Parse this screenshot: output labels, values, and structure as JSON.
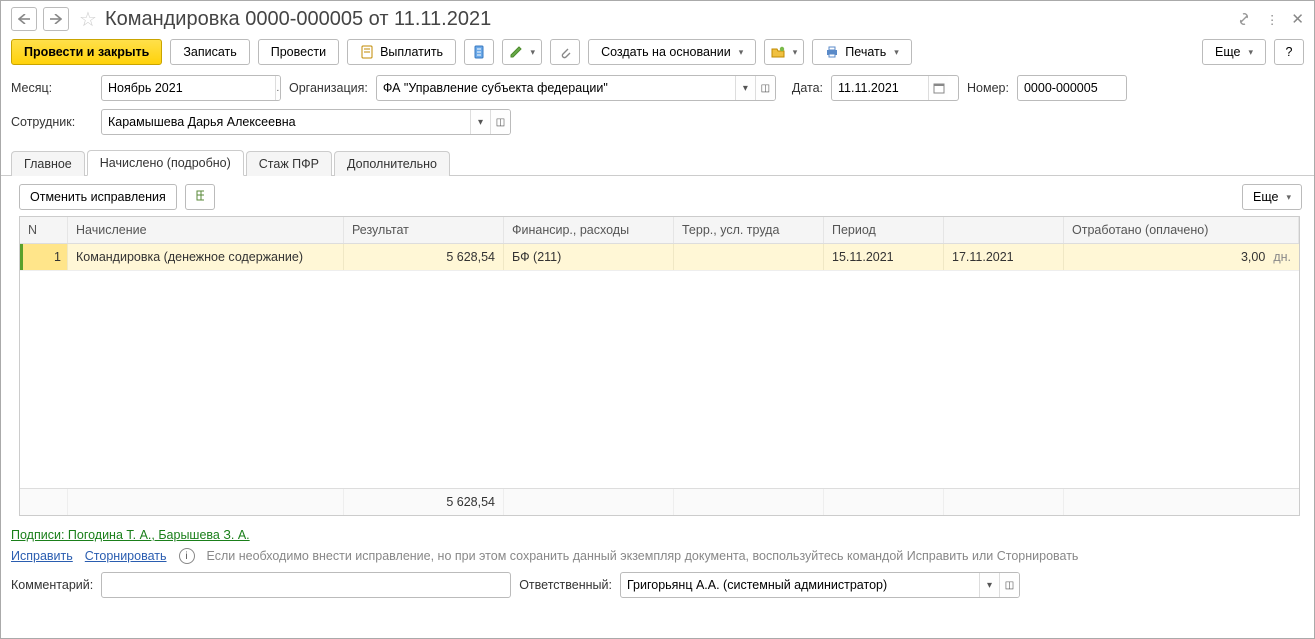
{
  "title": "Командировка 0000-000005 от 11.11.2021",
  "toolbar": {
    "post_close": "Провести и закрыть",
    "save": "Записать",
    "post": "Провести",
    "pay": "Выплатить",
    "create_based": "Создать на основании",
    "print": "Печать",
    "more": "Еще",
    "help": "?"
  },
  "labels": {
    "month": "Месяц:",
    "org": "Организация:",
    "date": "Дата:",
    "number": "Номер:",
    "employee": "Сотрудник:",
    "comment": "Комментарий:",
    "responsible": "Ответственный:"
  },
  "fields": {
    "month": "Ноябрь 2021",
    "org": "ФА \"Управление субъекта федерации\"",
    "date": "11.11.2021",
    "number": "0000-000005",
    "employee": "Карамышева Дарья Алексеевна",
    "comment": "",
    "responsible": "Григорьянц А.А. (системный администратор)"
  },
  "tabs": {
    "main": "Главное",
    "accruals": "Начислено (подробно)",
    "pfr": "Стаж ПФР",
    "extra": "Дополнительно"
  },
  "tab_toolbar": {
    "cancel_fix": "Отменить исправления",
    "more": "Еще"
  },
  "table": {
    "headers": {
      "n": "N",
      "accrual": "Начисление",
      "result": "Результат",
      "finance": "Финансир., расходы",
      "terr": "Терр., усл. труда",
      "period": "Период",
      "period2": "",
      "worked": "Отработано (оплачено)"
    },
    "rows": [
      {
        "n": "1",
        "accrual": "Командировка (денежное содержание)",
        "result": "5 628,54",
        "finance": "БФ  (211)",
        "terr": "",
        "period_from": "15.11.2021",
        "period_to": "17.11.2021",
        "worked_val": "3,00",
        "worked_unit": "дн."
      }
    ],
    "footer": {
      "result_total": "5 628,54"
    }
  },
  "signatures_label": "Подписи: Погодина Т. А., Барышева З. А.",
  "actions": {
    "fix": "Исправить",
    "storno": "Сторнировать"
  },
  "hint": "Если необходимо внести исправление, но при этом сохранить данный экземпляр документа, воспользуйтесь командой Исправить или Сторнировать"
}
